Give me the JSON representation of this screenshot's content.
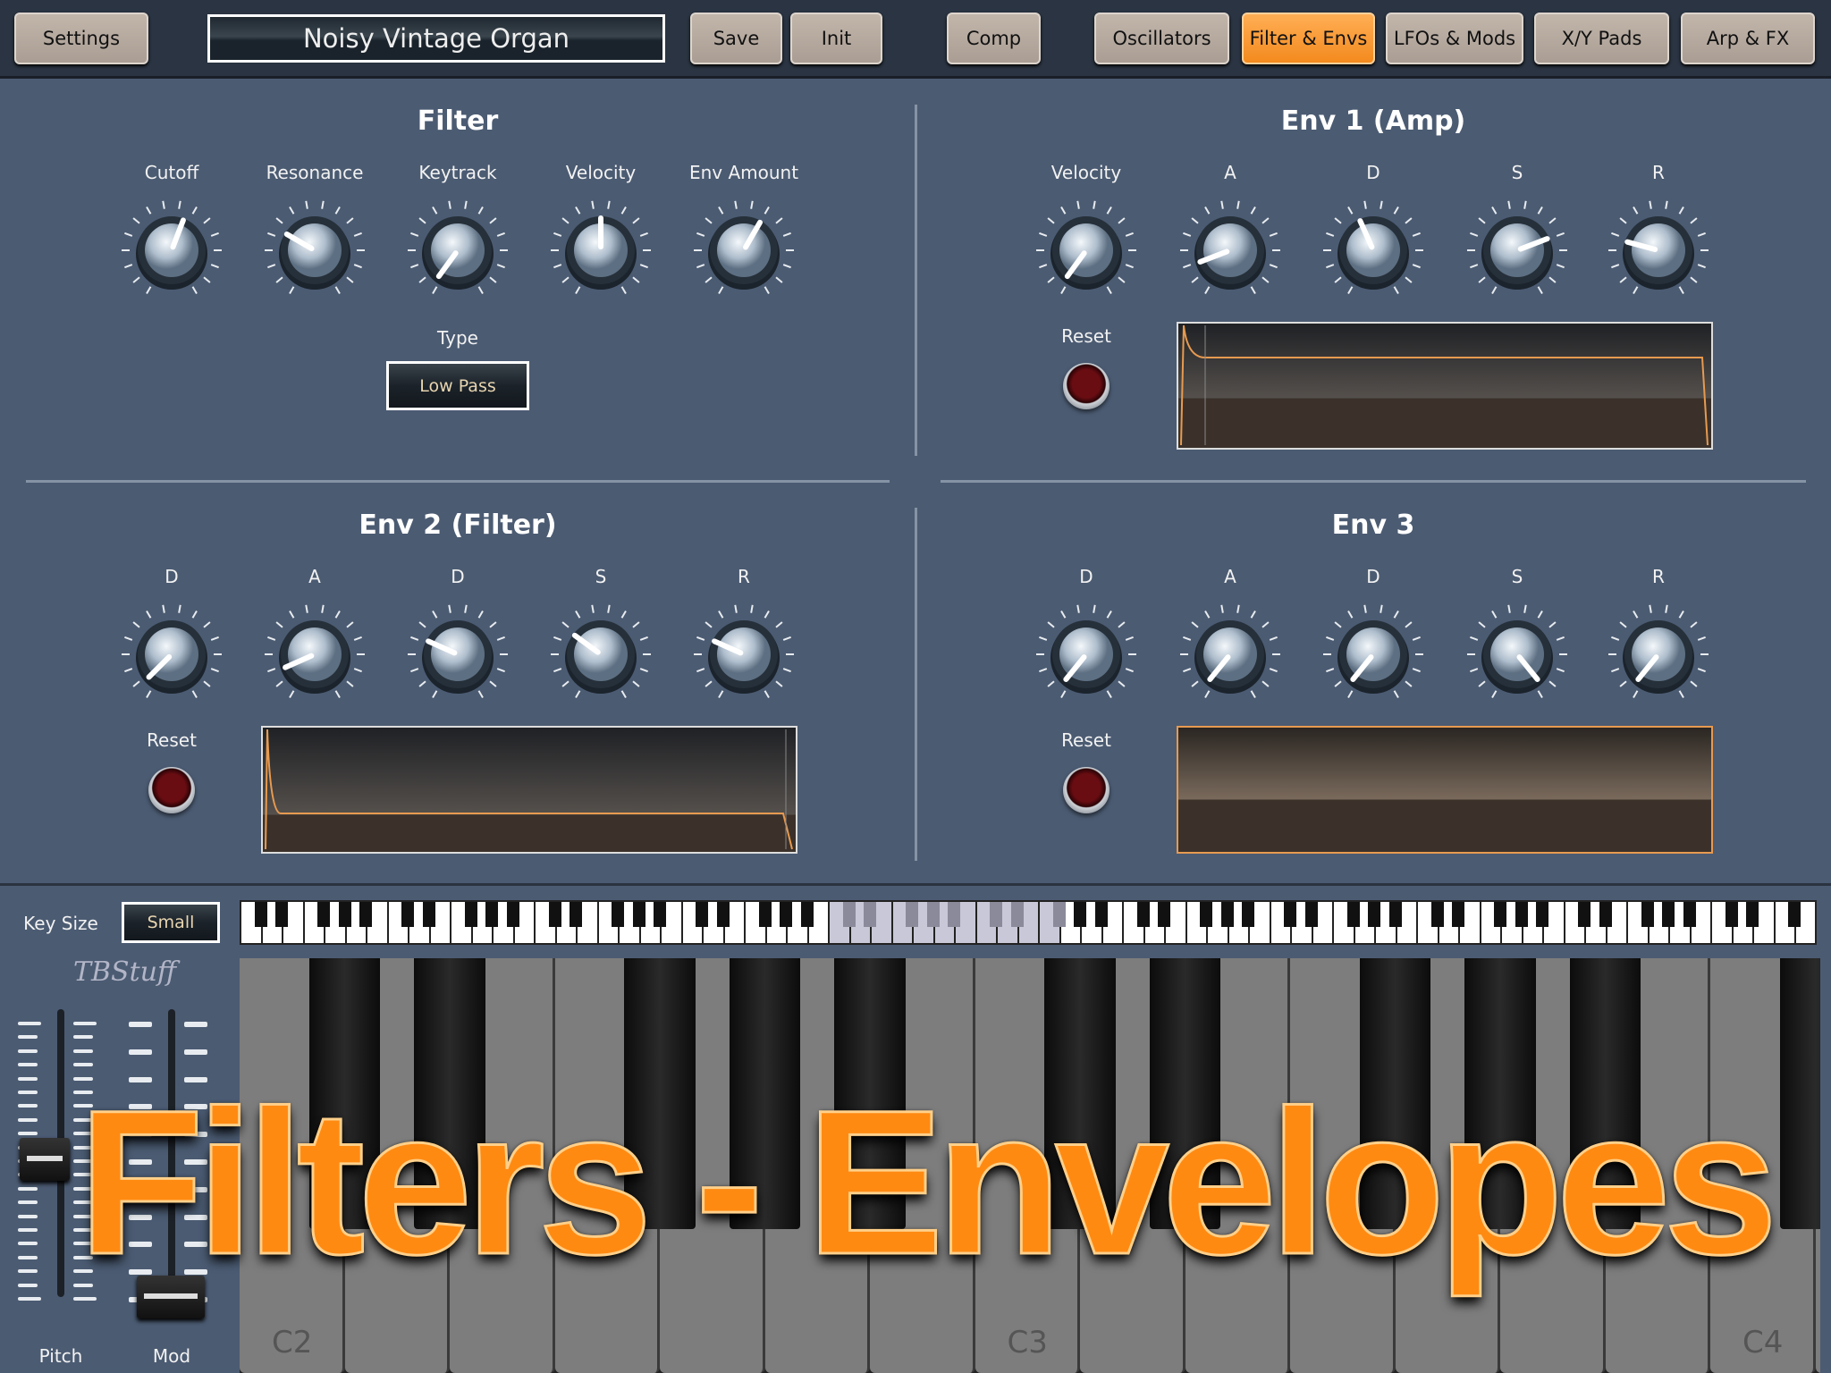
{
  "topbar": {
    "settings": "Settings",
    "preset_name": "Noisy Vintage Organ",
    "save": "Save",
    "init": "Init",
    "comp": "Comp",
    "tabs": [
      {
        "label": "Oscillators",
        "active": false
      },
      {
        "label": "Filter & Envs",
        "active": true
      },
      {
        "label": "LFOs & Mods",
        "active": false
      },
      {
        "label": "X/Y Pads",
        "active": false
      },
      {
        "label": "Arp & FX",
        "active": false
      }
    ]
  },
  "colors": {
    "accent": "#f38a1e",
    "panel": "#4b5b72"
  },
  "filter": {
    "title": "Filter",
    "type_label": "Type",
    "type_value": "Low Pass",
    "knobs": [
      {
        "label": "Cutoff",
        "value": 0.57
      },
      {
        "label": "Resonance",
        "value": 0.3
      },
      {
        "label": "Keytrack",
        "value": 0.02
      },
      {
        "label": "Velocity",
        "value": 0.5
      },
      {
        "label": "Env Amount",
        "value": 0.6
      }
    ]
  },
  "env1": {
    "title": "Env 1 (Amp)",
    "reset": "Reset",
    "knobs": [
      {
        "label": "Velocity",
        "value": 0.02
      },
      {
        "label": "A",
        "value": 0.13
      },
      {
        "label": "D",
        "value": 0.42
      },
      {
        "label": "S",
        "value": 0.73
      },
      {
        "label": "R",
        "value": 0.25
      }
    ]
  },
  "env2": {
    "title": "Env 2 (Filter)",
    "reset": "Reset",
    "knobs": [
      {
        "label": "D",
        "value": 0.05
      },
      {
        "label": "A",
        "value": 0.12
      },
      {
        "label": "D",
        "value": 0.28
      },
      {
        "label": "S",
        "value": 0.32
      },
      {
        "label": "R",
        "value": 0.28
      }
    ]
  },
  "env3": {
    "title": "Env 3",
    "reset": "Reset",
    "knobs": [
      {
        "label": "D",
        "value": 0.03
      },
      {
        "label": "A",
        "value": 0.03
      },
      {
        "label": "D",
        "value": 0.03
      },
      {
        "label": "S",
        "value": 0.97
      },
      {
        "label": "R",
        "value": 0.03
      }
    ]
  },
  "keyboard": {
    "key_size_label": "Key Size",
    "key_size_value": "Small",
    "notes": [
      "C2",
      "C3",
      "C4"
    ]
  },
  "sliders": {
    "pitch_label": "Pitch",
    "mod_label": "Mod",
    "pitch_value": 0.5,
    "mod_value": 0.0
  },
  "logo": "TBStuff",
  "overlay": "Filters - Envelopes"
}
